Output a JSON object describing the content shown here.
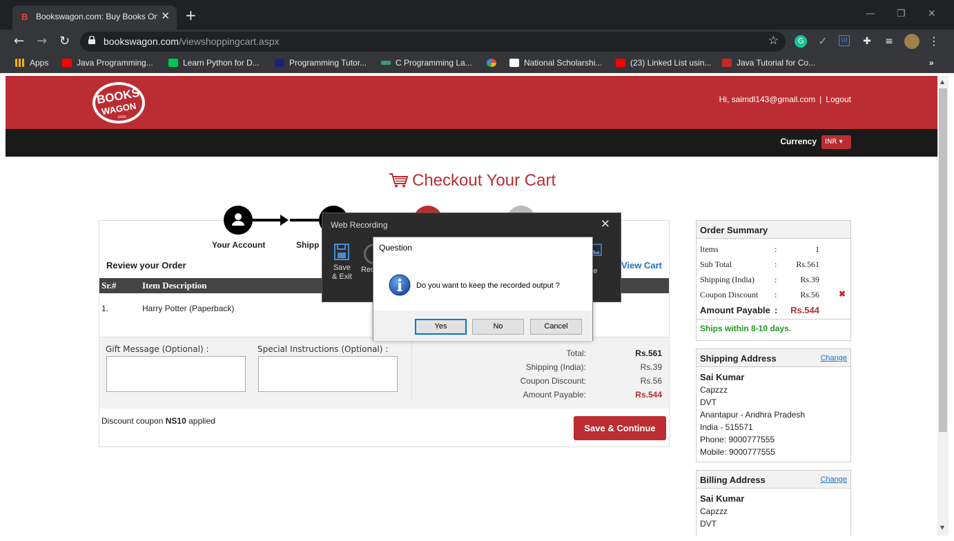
{
  "browser": {
    "tab_title": "Bookswagon.com: Buy Books Online",
    "tab_favicon": "B",
    "url_host": "bookswagon.com",
    "url_path": "/viewshoppingcart.aspx",
    "bookmarks": [
      {
        "label": "Apps",
        "color": "#f4b400"
      },
      {
        "label": "Java Programming...",
        "color": "#ff0000"
      },
      {
        "label": "Learn Python for D...",
        "color": "#00c853"
      },
      {
        "label": "Programming Tutor...",
        "color": "#1a237e"
      },
      {
        "label": "C Programming La...",
        "color": "#3d9970"
      },
      {
        "label": "",
        "color": "#fbbc05"
      },
      {
        "label": "National Scholarshi...",
        "color": "#ffffff"
      },
      {
        "label": "(23) Linked List usin...",
        "color": "#ff0000"
      },
      {
        "label": "Java Tutorial for Co...",
        "color": "#c62828"
      }
    ]
  },
  "site": {
    "greeting": "Hi, saimdl143@gmail.com",
    "logout": "Logout",
    "currency_label": "Currency",
    "currency_value": "INR",
    "logo_line1": "BOOKS",
    "logo_line2": "WAGON",
    "logo_line3": ".com"
  },
  "checkout": {
    "title": "Checkout Your Cart",
    "steps": [
      "Your Account",
      "Shipp"
    ],
    "review_title": "Review your Order",
    "view_cart": "View Cart",
    "table_headers": [
      "Sr.#",
      "Item Description"
    ],
    "items": [
      {
        "sr": "1.",
        "desc": "Harry Potter (Paperback)"
      }
    ],
    "gift_label": "Gift Message (Optional) :",
    "instructions_label": "Special Instructions (Optional) :",
    "totals": [
      {
        "label": "Total:",
        "value": "Rs.561"
      },
      {
        "label": "Shipping (India):",
        "value": "Rs.39"
      },
      {
        "label": "Coupon Discount:",
        "value": "Rs.56"
      },
      {
        "label": "Amount Payable:",
        "value": "Rs.544"
      }
    ],
    "coupon_prefix": "Discount coupon ",
    "coupon_code": "NS10",
    "coupon_suffix": " applied",
    "save_button": "Save & Continue"
  },
  "summary": {
    "title": "Order Summary",
    "rows": [
      {
        "label": "Items",
        "value": "1"
      },
      {
        "label": "Sub Total",
        "value": "Rs.561"
      },
      {
        "label": "Shipping (India)",
        "value": "Rs.39"
      },
      {
        "label": "Coupon Discount",
        "value": "Rs.56"
      },
      {
        "label": "Amount Payable",
        "value": "Rs.544"
      }
    ],
    "colon": ":",
    "ships_note": "Ships within 8-10 days."
  },
  "shipping": {
    "title": "Shipping Address",
    "change": "Change",
    "name": "Sai Kumar",
    "lines": [
      "Capzzz",
      "DVT",
      "Anantapur - Andhra Pradesh",
      "India - 515571",
      "Phone: 9000777555",
      "Mobile: 9000777555"
    ]
  },
  "billing": {
    "title": "Billing Address",
    "change": "Change",
    "name": "Sai Kumar",
    "lines": [
      "Capzzz",
      "DVT"
    ]
  },
  "recorder": {
    "title": "Web Recording",
    "save_exit_1": "Save",
    "save_exit_2": "& Exit",
    "record_partial": "Rec",
    "image_partial": "age"
  },
  "dialog": {
    "title": "Question",
    "message": "Do you want to keep the recorded output ?",
    "yes": "Yes",
    "no": "No",
    "cancel": "Cancel"
  }
}
